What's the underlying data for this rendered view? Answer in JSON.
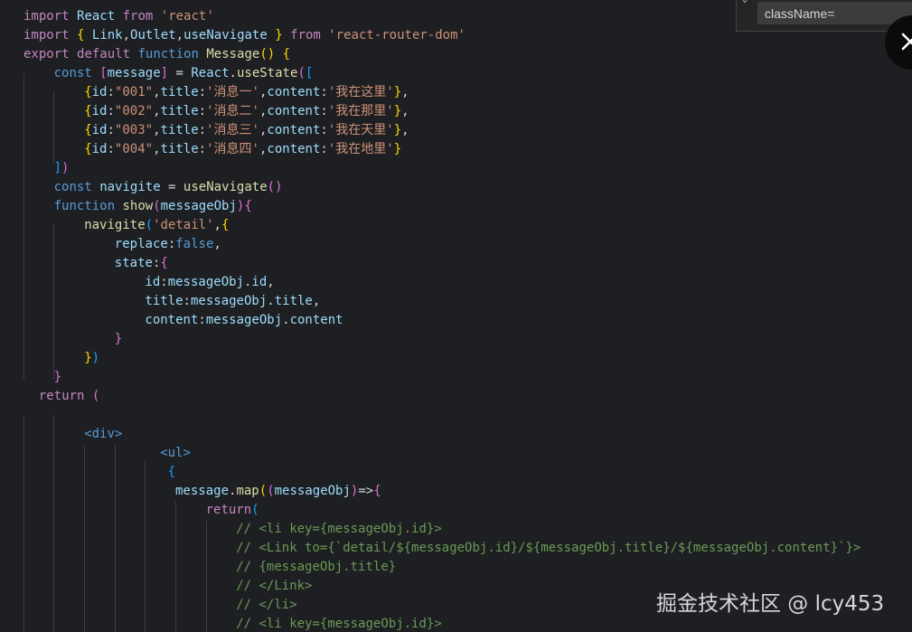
{
  "colors": {
    "background": "#1e1f22",
    "keyword": "#c586c0",
    "storage": "#569cd6",
    "identifier": "#9cdcfe",
    "function": "#dcdcaa",
    "class": "#4ec9b0",
    "string": "#ce9178",
    "comment": "#6a9955",
    "tag": "#569cd6",
    "punct": "#d4d4d4",
    "bracket1": "#ffd700",
    "bracket2": "#da70d6",
    "bracket3": "#179fff"
  },
  "code_lines": [
    {
      "indent": 0,
      "tokens": [
        {
          "t": "import",
          "c": "keyword"
        },
        {
          "t": " "
        },
        {
          "t": "React",
          "c": "identifier"
        },
        {
          "t": " "
        },
        {
          "t": "from",
          "c": "keyword"
        },
        {
          "t": " "
        },
        {
          "t": "'react'",
          "c": "string"
        }
      ]
    },
    {
      "indent": 0,
      "tokens": [
        {
          "t": "import",
          "c": "keyword"
        },
        {
          "t": " "
        },
        {
          "t": "{",
          "c": "bracket1"
        },
        {
          "t": " "
        },
        {
          "t": "Link",
          "c": "identifier"
        },
        {
          "t": ","
        },
        {
          "t": "Outlet",
          "c": "identifier"
        },
        {
          "t": ","
        },
        {
          "t": "useNavigate",
          "c": "identifier"
        },
        {
          "t": " "
        },
        {
          "t": "}",
          "c": "bracket1"
        },
        {
          "t": " "
        },
        {
          "t": "from",
          "c": "keyword"
        },
        {
          "t": " "
        },
        {
          "t": "'react-router-dom'",
          "c": "string"
        }
      ]
    },
    {
      "indent": 0,
      "tokens": [
        {
          "t": "export",
          "c": "keyword"
        },
        {
          "t": " "
        },
        {
          "t": "default",
          "c": "keyword"
        },
        {
          "t": " "
        },
        {
          "t": "function",
          "c": "storage"
        },
        {
          "t": " "
        },
        {
          "t": "Message",
          "c": "function"
        },
        {
          "t": "()",
          "c": "bracket1"
        },
        {
          "t": " "
        },
        {
          "t": "{",
          "c": "bracket1"
        }
      ]
    },
    {
      "indent": 1,
      "tokens": [
        {
          "t": "const",
          "c": "storage"
        },
        {
          "t": " "
        },
        {
          "t": "[",
          "c": "bracket2"
        },
        {
          "t": "message",
          "c": "identifier"
        },
        {
          "t": "]",
          "c": "bracket2"
        },
        {
          "t": " = "
        },
        {
          "t": "React",
          "c": "identifier"
        },
        {
          "t": "."
        },
        {
          "t": "useState",
          "c": "function"
        },
        {
          "t": "(",
          "c": "bracket2"
        },
        {
          "t": "[",
          "c": "bracket3"
        }
      ]
    },
    {
      "indent": 2,
      "tokens": [
        {
          "t": "{",
          "c": "bracket1"
        },
        {
          "t": "id",
          "c": "identifier"
        },
        {
          "t": ":"
        },
        {
          "t": "\"001\"",
          "c": "string"
        },
        {
          "t": ","
        },
        {
          "t": "title",
          "c": "identifier"
        },
        {
          "t": ":"
        },
        {
          "t": "'消息一'",
          "c": "string"
        },
        {
          "t": ","
        },
        {
          "t": "content",
          "c": "identifier"
        },
        {
          "t": ":"
        },
        {
          "t": "'我在这里'",
          "c": "string"
        },
        {
          "t": "}",
          "c": "bracket1"
        },
        {
          "t": ","
        }
      ]
    },
    {
      "indent": 2,
      "tokens": [
        {
          "t": "{",
          "c": "bracket1"
        },
        {
          "t": "id",
          "c": "identifier"
        },
        {
          "t": ":"
        },
        {
          "t": "\"002\"",
          "c": "string"
        },
        {
          "t": ","
        },
        {
          "t": "title",
          "c": "identifier"
        },
        {
          "t": ":"
        },
        {
          "t": "'消息二'",
          "c": "string"
        },
        {
          "t": ","
        },
        {
          "t": "content",
          "c": "identifier"
        },
        {
          "t": ":"
        },
        {
          "t": "'我在那里'",
          "c": "string"
        },
        {
          "t": "}",
          "c": "bracket1"
        },
        {
          "t": ","
        }
      ]
    },
    {
      "indent": 2,
      "tokens": [
        {
          "t": "{",
          "c": "bracket1"
        },
        {
          "t": "id",
          "c": "identifier"
        },
        {
          "t": ":"
        },
        {
          "t": "\"003\"",
          "c": "string"
        },
        {
          "t": ","
        },
        {
          "t": "title",
          "c": "identifier"
        },
        {
          "t": ":"
        },
        {
          "t": "'消息三'",
          "c": "string"
        },
        {
          "t": ","
        },
        {
          "t": "content",
          "c": "identifier"
        },
        {
          "t": ":"
        },
        {
          "t": "'我在天里'",
          "c": "string"
        },
        {
          "t": "}",
          "c": "bracket1"
        },
        {
          "t": ","
        }
      ]
    },
    {
      "indent": 2,
      "tokens": [
        {
          "t": "{",
          "c": "bracket1"
        },
        {
          "t": "id",
          "c": "identifier"
        },
        {
          "t": ":"
        },
        {
          "t": "\"004\"",
          "c": "string"
        },
        {
          "t": ","
        },
        {
          "t": "title",
          "c": "identifier"
        },
        {
          "t": ":"
        },
        {
          "t": "'消息四'",
          "c": "string"
        },
        {
          "t": ","
        },
        {
          "t": "content",
          "c": "identifier"
        },
        {
          "t": ":"
        },
        {
          "t": "'我在地里'",
          "c": "string"
        },
        {
          "t": "}",
          "c": "bracket1"
        }
      ]
    },
    {
      "indent": 1,
      "tokens": [
        {
          "t": "]",
          "c": "bracket3"
        },
        {
          "t": ")",
          "c": "bracket2"
        }
      ]
    },
    {
      "indent": 1,
      "tokens": [
        {
          "t": "const",
          "c": "storage"
        },
        {
          "t": " "
        },
        {
          "t": "navigite",
          "c": "identifier"
        },
        {
          "t": " = "
        },
        {
          "t": "useNavigate",
          "c": "function"
        },
        {
          "t": "()",
          "c": "bracket2"
        }
      ]
    },
    {
      "indent": 1,
      "tokens": [
        {
          "t": "function",
          "c": "storage"
        },
        {
          "t": " "
        },
        {
          "t": "show",
          "c": "function"
        },
        {
          "t": "(",
          "c": "bracket2"
        },
        {
          "t": "messageObj",
          "c": "identifier"
        },
        {
          "t": ")",
          "c": "bracket2"
        },
        {
          "t": "{",
          "c": "bracket2"
        }
      ]
    },
    {
      "indent": 2,
      "tokens": [
        {
          "t": "navigite",
          "c": "function"
        },
        {
          "t": "(",
          "c": "bracket3"
        },
        {
          "t": "'detail'",
          "c": "string"
        },
        {
          "t": ","
        },
        {
          "t": "{",
          "c": "bracket1"
        }
      ]
    },
    {
      "indent": 3,
      "tokens": [
        {
          "t": "replace",
          "c": "identifier"
        },
        {
          "t": ":"
        },
        {
          "t": "false",
          "c": "storage"
        },
        {
          "t": ","
        }
      ]
    },
    {
      "indent": 3,
      "tokens": [
        {
          "t": "state",
          "c": "identifier"
        },
        {
          "t": ":"
        },
        {
          "t": "{",
          "c": "bracket2"
        }
      ]
    },
    {
      "indent": 4,
      "tokens": [
        {
          "t": "id",
          "c": "identifier"
        },
        {
          "t": ":"
        },
        {
          "t": "messageObj",
          "c": "identifier"
        },
        {
          "t": "."
        },
        {
          "t": "id",
          "c": "identifier"
        },
        {
          "t": ","
        }
      ]
    },
    {
      "indent": 4,
      "tokens": [
        {
          "t": "title",
          "c": "identifier"
        },
        {
          "t": ":"
        },
        {
          "t": "messageObj",
          "c": "identifier"
        },
        {
          "t": "."
        },
        {
          "t": "title",
          "c": "identifier"
        },
        {
          "t": ","
        }
      ]
    },
    {
      "indent": 4,
      "tokens": [
        {
          "t": "content",
          "c": "identifier"
        },
        {
          "t": ":"
        },
        {
          "t": "messageObj",
          "c": "identifier"
        },
        {
          "t": "."
        },
        {
          "t": "content",
          "c": "identifier"
        }
      ]
    },
    {
      "indent": 3,
      "tokens": [
        {
          "t": "}",
          "c": "bracket2"
        }
      ]
    },
    {
      "indent": 2,
      "tokens": [
        {
          "t": "}",
          "c": "bracket1"
        },
        {
          "t": ")",
          "c": "bracket3"
        }
      ]
    },
    {
      "indent": 1,
      "tokens": [
        {
          "t": "}",
          "c": "bracket2"
        }
      ]
    },
    {
      "indent": 0.5,
      "tokens": [
        {
          "t": "return",
          "c": "keyword"
        },
        {
          "t": " "
        },
        {
          "t": "(",
          "c": "bracket2"
        }
      ]
    },
    {
      "indent": 0,
      "tokens": []
    },
    {
      "indent": 2,
      "tokens": [
        {
          "t": "<div>",
          "c": "tag"
        }
      ]
    },
    {
      "indent": 4.5,
      "tokens": [
        {
          "t": "<ul>",
          "c": "tag"
        }
      ]
    },
    {
      "indent": 4.75,
      "tokens": [
        {
          "t": "{",
          "c": "bracket3"
        }
      ]
    },
    {
      "indent": 5,
      "tokens": [
        {
          "t": "message",
          "c": "identifier"
        },
        {
          "t": "."
        },
        {
          "t": "map",
          "c": "function"
        },
        {
          "t": "(",
          "c": "bracket1"
        },
        {
          "t": "(",
          "c": "bracket2"
        },
        {
          "t": "messageObj",
          "c": "identifier"
        },
        {
          "t": ")",
          "c": "bracket2"
        },
        {
          "t": "=>"
        },
        {
          "t": "{",
          "c": "bracket2"
        }
      ]
    },
    {
      "indent": 6,
      "tokens": [
        {
          "t": "return",
          "c": "keyword"
        },
        {
          "t": "(",
          "c": "bracket3"
        }
      ]
    },
    {
      "indent": 7,
      "tokens": [
        {
          "t": "// <li key={messageObj.id}>",
          "c": "comment"
        }
      ]
    },
    {
      "indent": 7,
      "tokens": [
        {
          "t": "// <Link to={`detail/${messageObj.id}/${messageObj.title}/${messageObj.content}`}>",
          "c": "comment"
        }
      ]
    },
    {
      "indent": 7,
      "tokens": [
        {
          "t": "// {messageObj.title}",
          "c": "comment"
        }
      ]
    },
    {
      "indent": 7,
      "tokens": [
        {
          "t": "// </Link>",
          "c": "comment"
        }
      ]
    },
    {
      "indent": 7,
      "tokens": [
        {
          "t": "// </li>",
          "c": "comment"
        }
      ]
    },
    {
      "indent": 7,
      "tokens": [
        {
          "t": "// <li key={messageObj.id}>",
          "c": "comment"
        }
      ]
    }
  ],
  "suggest": {
    "chevron": "⌄",
    "value": "className="
  },
  "close_icon": "close-icon",
  "watermark": "掘金技术社区 @ lcy453"
}
